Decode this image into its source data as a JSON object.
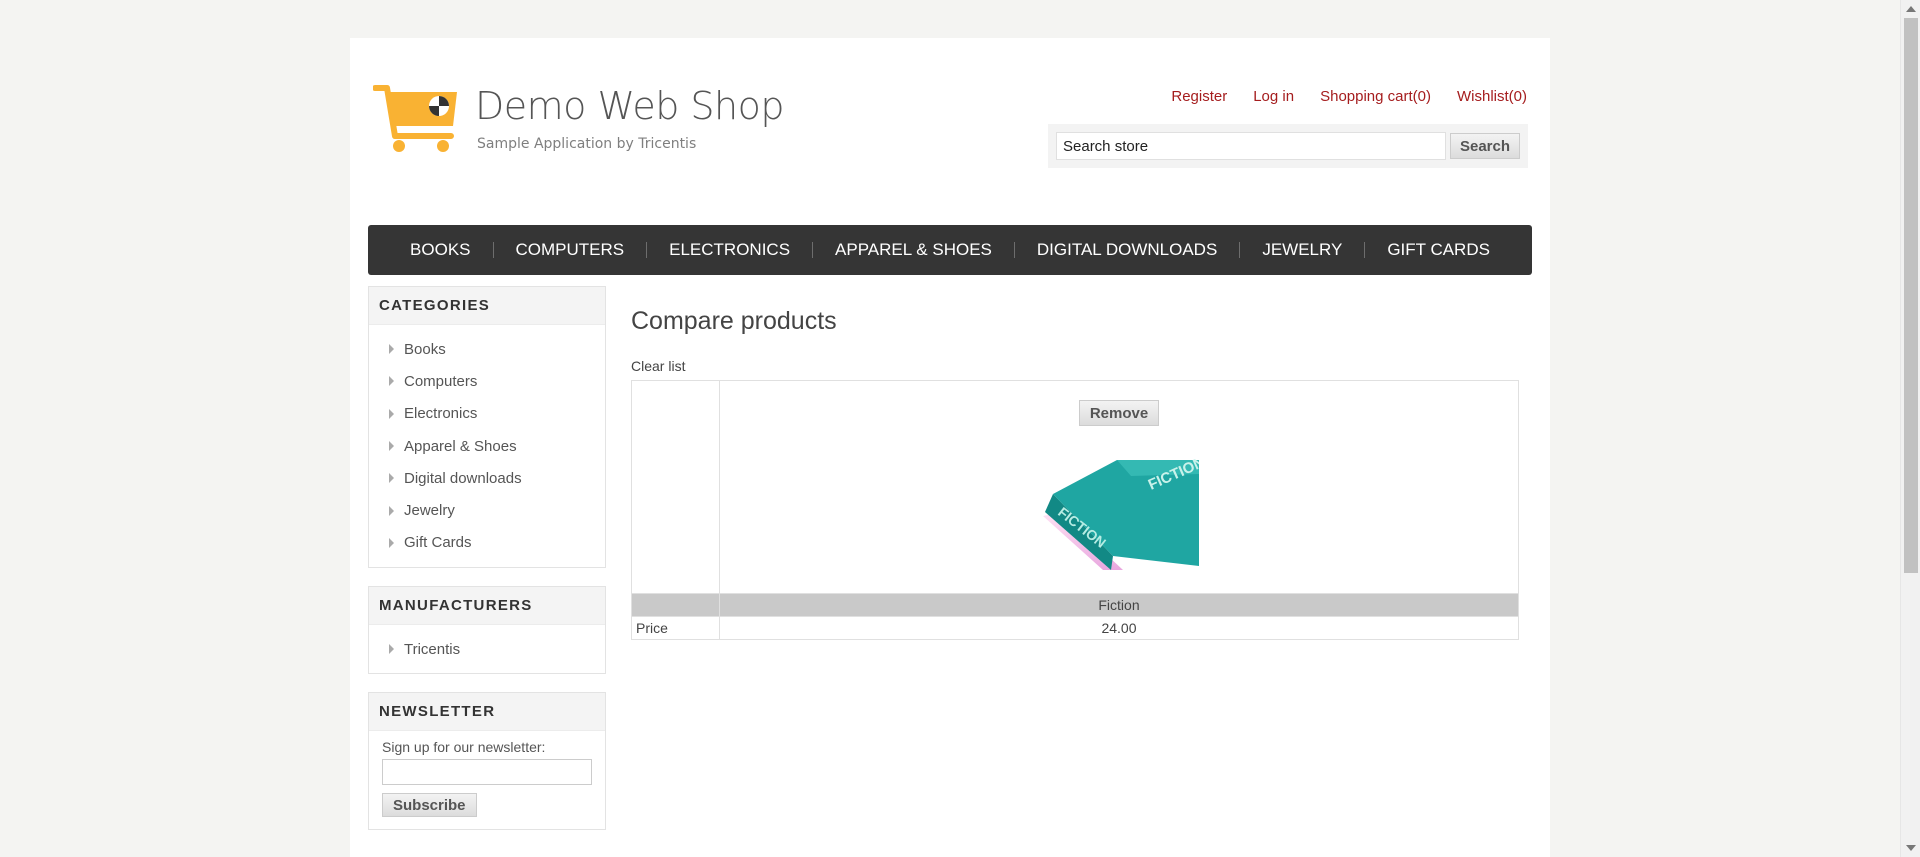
{
  "header": {
    "logo_title": "Demo Web Shop",
    "logo_subtitle": "Sample Application by Tricentis",
    "links": [
      "Register",
      "Log in",
      "Shopping cart(0)",
      "Wishlist(0)"
    ],
    "search_value": "Search store",
    "search_button": "Search"
  },
  "top_menu": {
    "items": [
      "BOOKS",
      "COMPUTERS",
      "ELECTRONICS",
      "APPAREL & SHOES",
      "DIGITAL DOWNLOADS",
      "JEWELRY",
      "GIFT CARDS"
    ]
  },
  "sidebar": {
    "categories_title": "CATEGORIES",
    "categories": [
      "Books",
      "Computers",
      "Electronics",
      "Apparel & Shoes",
      "Digital downloads",
      "Jewelry",
      "Gift Cards"
    ],
    "manufacturers_title": "MANUFACTURERS",
    "manufacturers": [
      "Tricentis"
    ],
    "newsletter_title": "NEWSLETTER",
    "newsletter_label": "Sign up for our newsletter:",
    "subscribe_button": "Subscribe"
  },
  "main": {
    "title": "Compare products",
    "clear_list": "Clear list",
    "remove_button": "Remove",
    "product": {
      "name": "Fiction",
      "price_label": "Price",
      "price": "24.00",
      "cover_text": "FICTION"
    }
  },
  "colors": {
    "link_red": "#a51d1e",
    "menu_bg": "#353535",
    "page_bg": "#f4f4f2",
    "logo_orange": "#f9b233",
    "book_teal": "#1a9e9c"
  }
}
